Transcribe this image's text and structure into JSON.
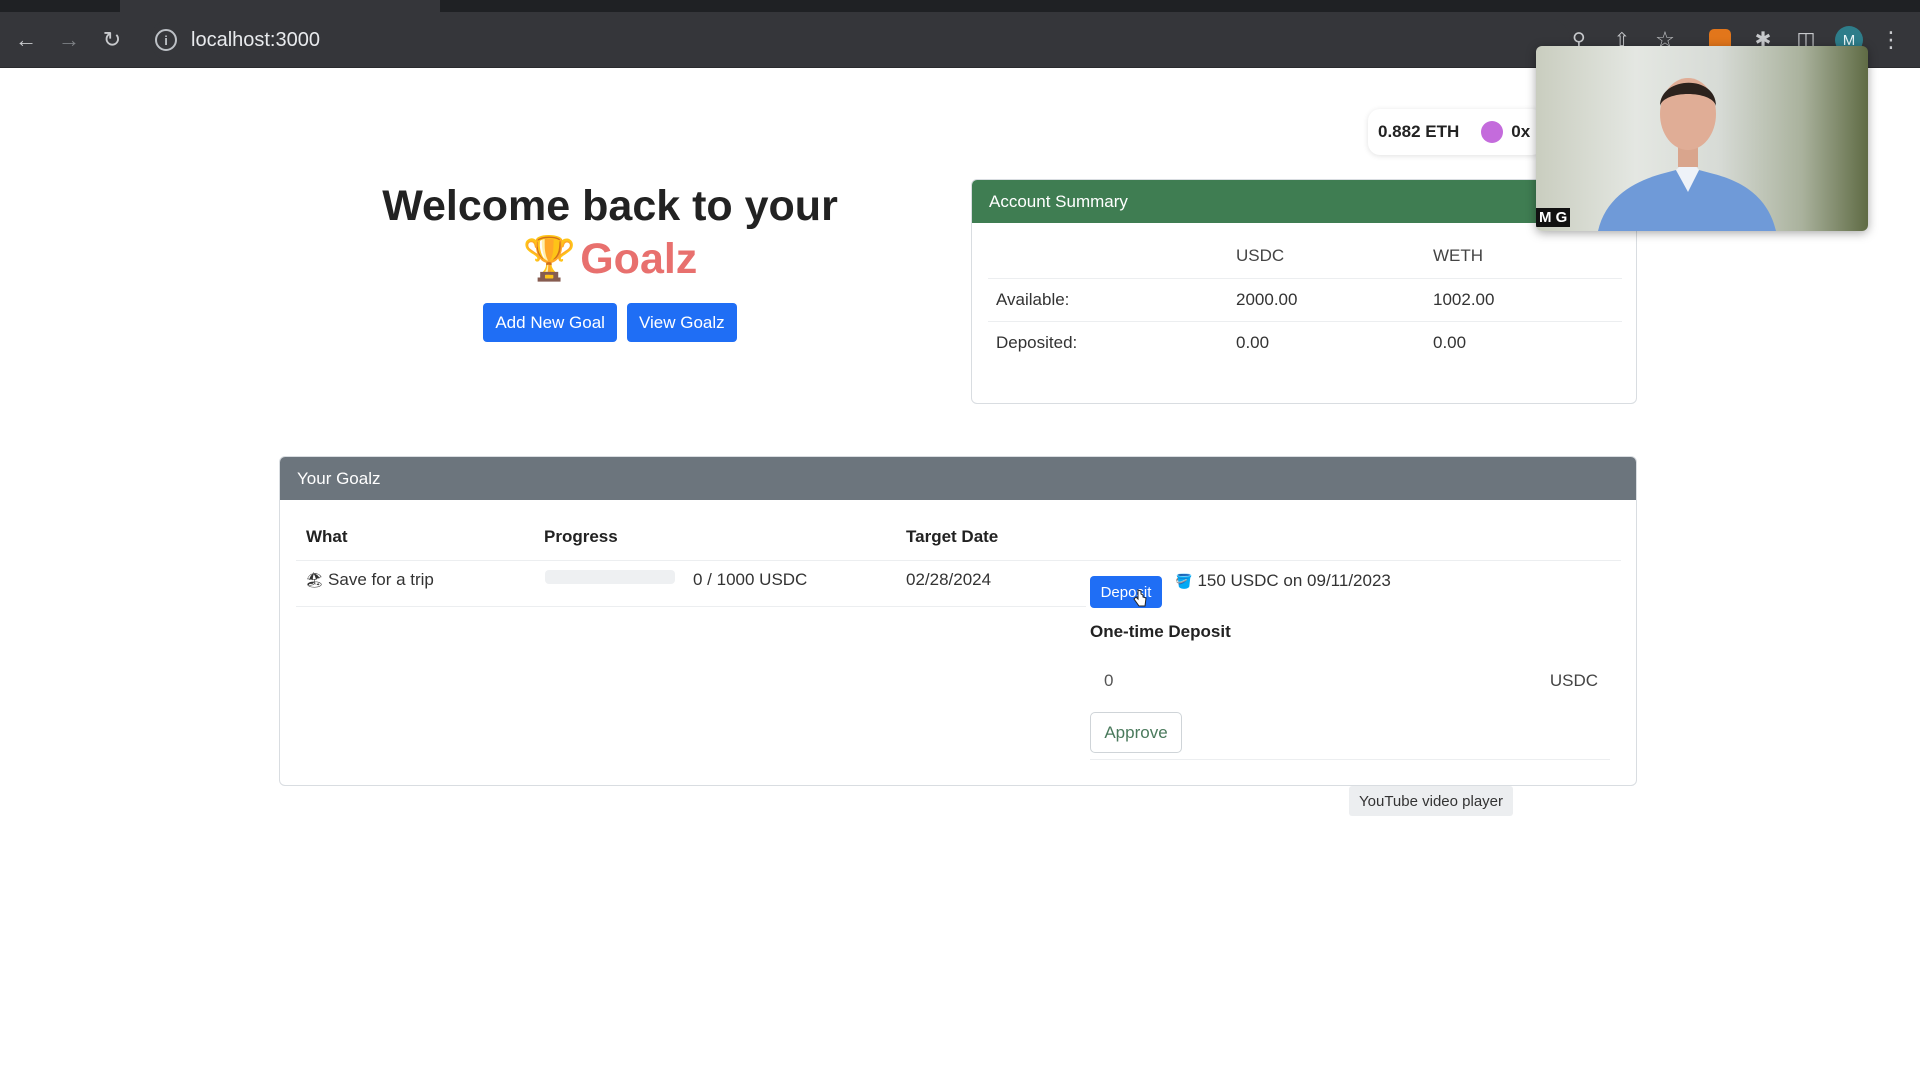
{
  "browser": {
    "url": "localhost:3000",
    "profile_initial": "M"
  },
  "wallet": {
    "balance": "0.882 ETH",
    "address": "0x"
  },
  "hero": {
    "line1": "Welcome back to your",
    "brand": "Goalz",
    "trophy_icon": "🏆",
    "add_goal_label": "Add New Goal",
    "view_goalz_label": "View Goalz"
  },
  "account_summary": {
    "title": "Account Summary",
    "columns": [
      "",
      "USDC",
      "WETH"
    ],
    "rows": [
      {
        "label": "Available:",
        "usdc": "2000.00",
        "weth": "1002.00"
      },
      {
        "label": "Deposited:",
        "usdc": "0.00",
        "weth": "0.00"
      }
    ]
  },
  "goalz": {
    "title": "Your Goalz",
    "headers": {
      "what": "What",
      "progress": "Progress",
      "target_date": "Target Date"
    },
    "rows": [
      {
        "emoji": "🏖",
        "what": "Save for a trip",
        "progress_fraction": 0,
        "progress_text": "0 / 1000 USDC",
        "target_date": "02/28/2024",
        "deposit_label": "Deposit",
        "schedule_icon": "🪣",
        "schedule_text": "150 USDC on 09/11/2023"
      }
    ],
    "one_time_deposit": {
      "label": "One-time Deposit",
      "value": "0",
      "unit": "USDC",
      "approve_label": "Approve"
    }
  },
  "tooltip": "YouTube video player",
  "webcam": {
    "tag": "M G"
  },
  "colors": {
    "primary": "#1f6ef5",
    "account_header": "#3f7d52",
    "goalz_header": "#6c757d",
    "brand": "#e8706e"
  }
}
